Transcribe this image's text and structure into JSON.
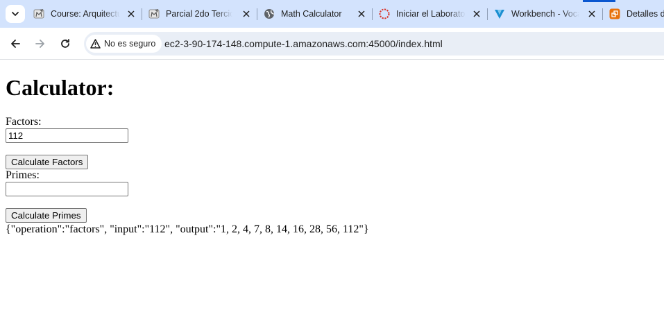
{
  "tabs": [
    {
      "title": "Course: Arquitectu",
      "icon": "moodle-icon"
    },
    {
      "title": "Parcial 2do Tercio",
      "icon": "moodle-icon"
    },
    {
      "title": "Math Calculator",
      "icon": "globe-icon"
    },
    {
      "title": "Iniciar el Laborato",
      "icon": "loading-icon"
    },
    {
      "title": "Workbench - Voca",
      "icon": "vocareum-icon"
    },
    {
      "title": "Detalles de",
      "icon": "aws-icon"
    }
  ],
  "toolbar": {
    "security_label": "No es seguro",
    "url": "ec2-3-90-174-148.compute-1.amazonaws.com:45000/index.html"
  },
  "page": {
    "heading": "Calculator:",
    "factors_label": "Factors:",
    "factors_value": "112",
    "factors_button": "Calculate Factors",
    "primes_label": "Primes:",
    "primes_value": "",
    "primes_button": "Calculate Primes",
    "result": "{\"operation\":\"factors\", \"input\":\"112\", \"output\":\"1, 2, 4, 7, 8, 14, 16, 28, 56, 112\"}"
  },
  "colors": {
    "tabstrip_bg": "#d3e3fd",
    "omnibox_bg": "#e9eef6",
    "accent": "#0b57d0"
  }
}
